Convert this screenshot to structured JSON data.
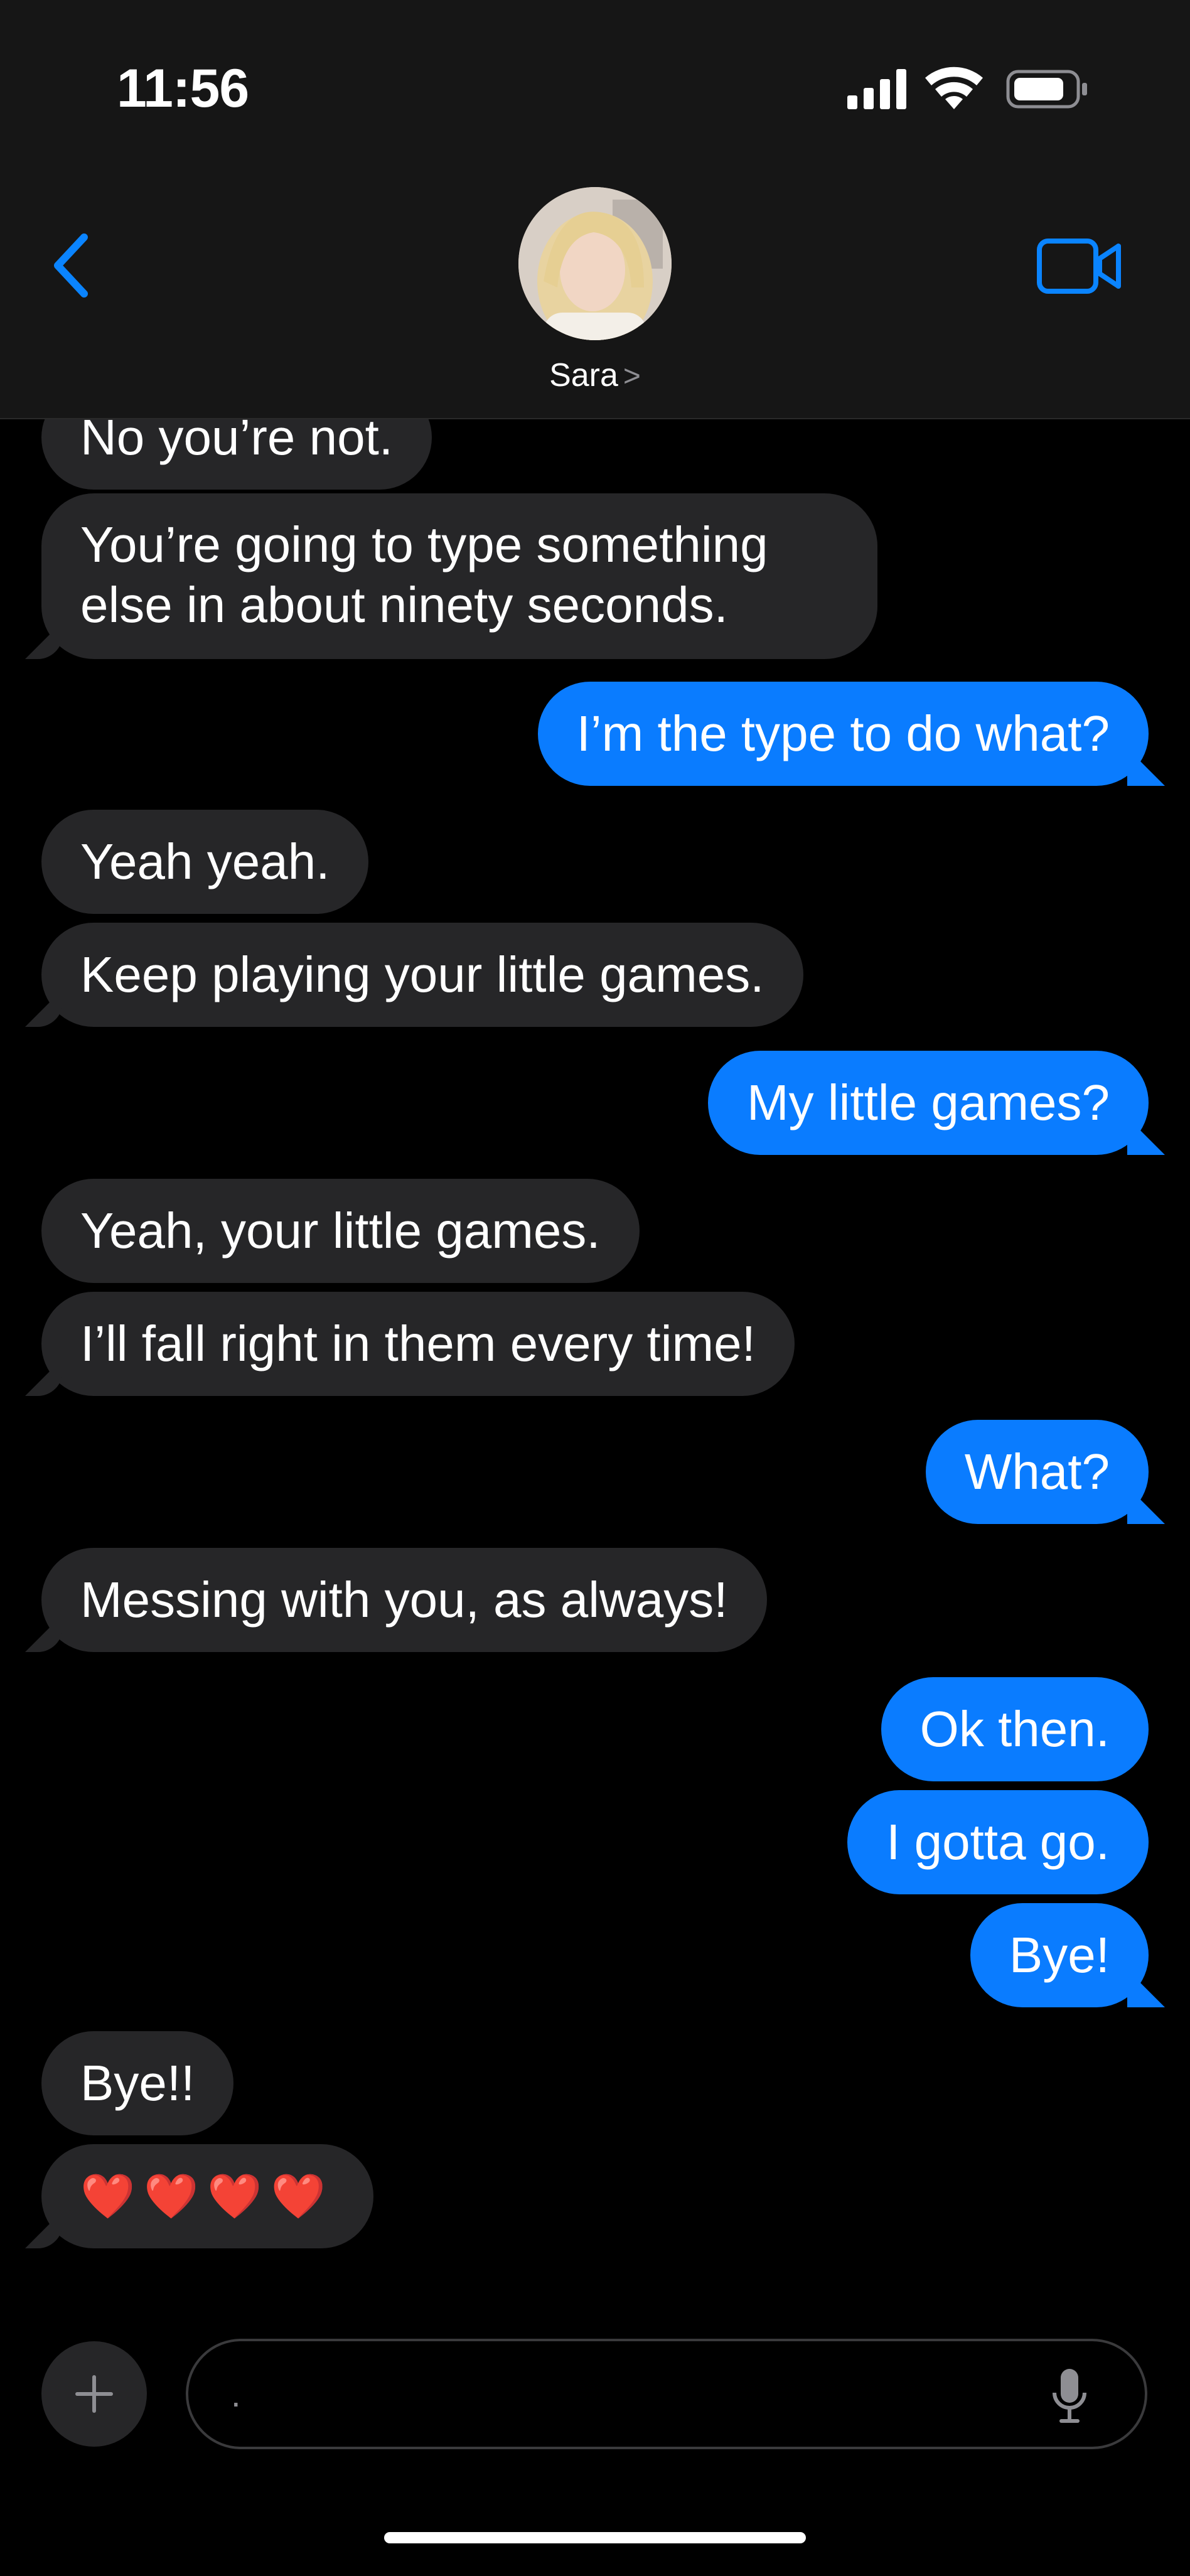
{
  "status": {
    "time": "11:56"
  },
  "header": {
    "contact_name": "Sara",
    "name_chevron": ">"
  },
  "messages": [
    {
      "from": "them",
      "text": "No you’re not."
    },
    {
      "from": "them",
      "text": "You’re going to type something else in about ninety seconds."
    },
    {
      "from": "me",
      "text": "I’m the type to do what?"
    },
    {
      "from": "them",
      "text": "Yeah yeah."
    },
    {
      "from": "them",
      "text": "Keep playing your little games."
    },
    {
      "from": "me",
      "text": "My little games?"
    },
    {
      "from": "them",
      "text": "Yeah, your little games."
    },
    {
      "from": "them",
      "text": "I’ll fall right in them every time!"
    },
    {
      "from": "me",
      "text": "What?"
    },
    {
      "from": "them",
      "text": "Messing with you, as always!"
    },
    {
      "from": "me",
      "text": "Ok then."
    },
    {
      "from": "me",
      "text": "I gotta go."
    },
    {
      "from": "me",
      "text": "Bye!"
    },
    {
      "from": "them",
      "text": "Bye!!"
    },
    {
      "from": "them",
      "text": "❤️❤️❤️❤️"
    }
  ],
  "composer": {
    "value": "."
  },
  "colors": {
    "outgoing": "#0a7cff",
    "incoming": "#262628",
    "accent": "#0a84ff"
  }
}
